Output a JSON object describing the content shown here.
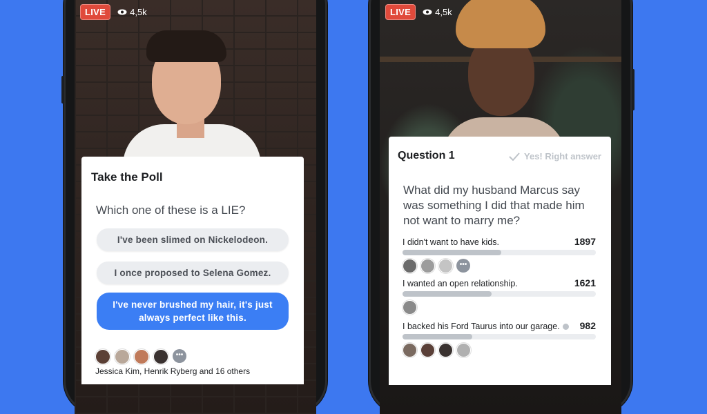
{
  "colors": {
    "background": "#3d78f0",
    "live": "#e04a3b",
    "selected_option": "#3b7ef4"
  },
  "left_stream": {
    "live_label": "LIVE",
    "viewers": "4,5k",
    "poll": {
      "title": "Take the Poll",
      "question": "Which one of these is a LIE?",
      "options": [
        {
          "label": "I've been slimed on Nickelodeon.",
          "selected": false
        },
        {
          "label": "I once proposed to Selena Gomez.",
          "selected": false
        },
        {
          "label": "I've never brushed my hair, it's just always perfect like this.",
          "selected": true
        }
      ],
      "voters_text": "Jessica Kim, Henrik Ryberg and 16 others",
      "more_icon": "ellipsis-icon"
    }
  },
  "right_stream": {
    "live_label": "LIVE",
    "viewers": "4,5k",
    "quiz": {
      "title": "Question 1",
      "status": "Yes! Right answer",
      "question": "What did my husband Marcus say was something I did that made him not want to marry me?",
      "answers": [
        {
          "label": "I didn't want to have kids.",
          "count": "1897",
          "progress": 0.51
        },
        {
          "label": "I wanted an open relationship.",
          "count": "1621",
          "progress": 0.46
        },
        {
          "label": "I backed his Ford Taurus into our garage.",
          "count": "982",
          "progress": 0.36
        }
      ]
    }
  }
}
